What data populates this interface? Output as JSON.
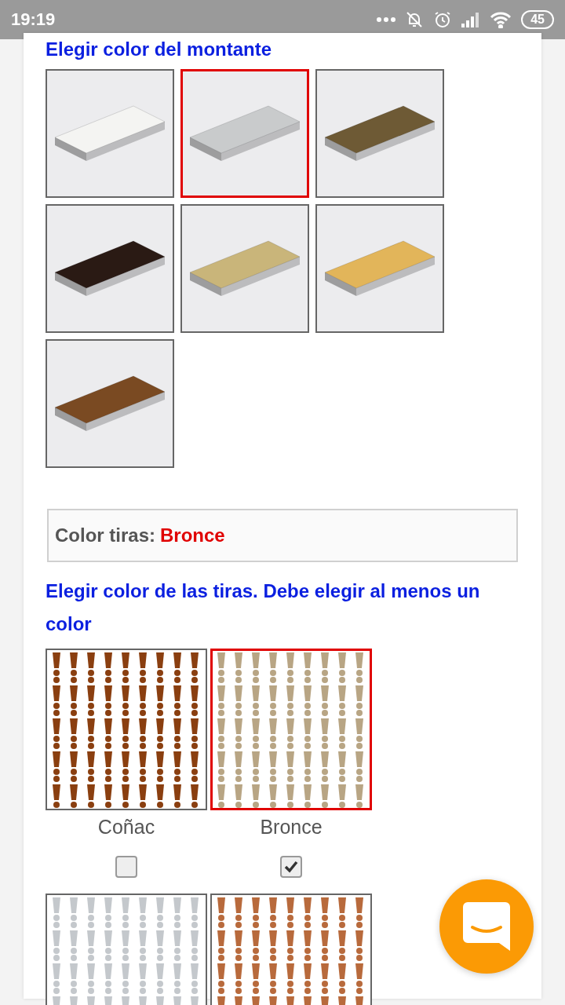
{
  "status_bar": {
    "time": "19:19",
    "battery": "45"
  },
  "montante": {
    "heading": "Elegir color del montante",
    "swatches": [
      {
        "selected": false,
        "color": "#f4f4f2"
      },
      {
        "selected": true,
        "color": "#c9cbcc"
      },
      {
        "selected": false,
        "color": "#6e5a35"
      },
      {
        "selected": false,
        "color": "#2a1a14"
      },
      {
        "selected": false,
        "color": "#c9b57a"
      },
      {
        "selected": false,
        "color": "#e2b55a"
      },
      {
        "selected": false,
        "color": "#7a4a22"
      }
    ]
  },
  "tiras_summary": {
    "label": "Color tiras:",
    "value": "Bronce"
  },
  "tiras": {
    "heading": "Elegir color de las tiras. Debe elegir al menos un color",
    "swatches": [
      {
        "name": "Coñac",
        "selected": false,
        "checked": false,
        "color": "#8a3f10"
      },
      {
        "name": "Bronce",
        "selected": true,
        "checked": true,
        "color": "#b8a584"
      },
      {
        "selected": false,
        "color": "#c4c8cc"
      },
      {
        "selected": false,
        "color": "#b86a3c"
      }
    ]
  }
}
